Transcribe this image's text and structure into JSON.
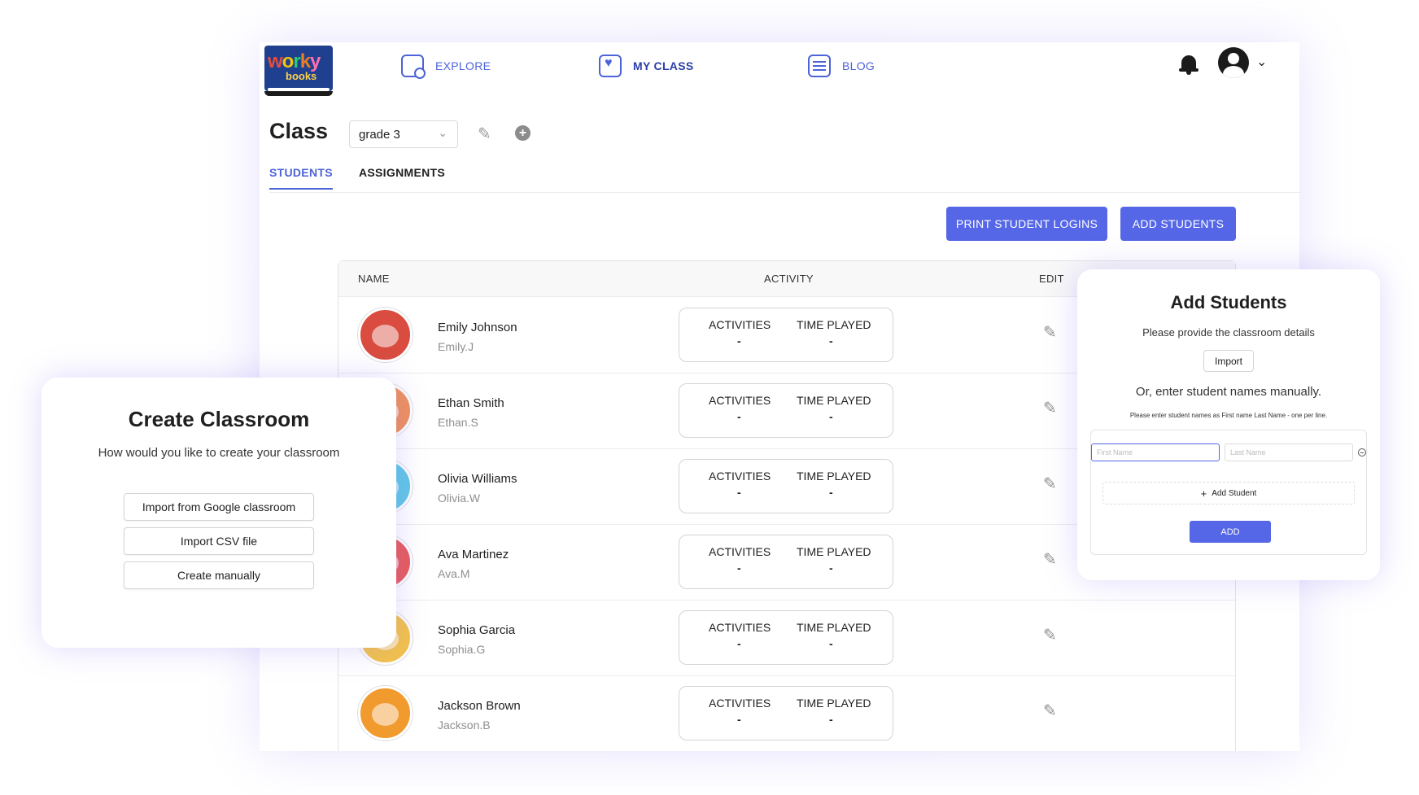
{
  "nav": {
    "items": [
      {
        "label": "EXPLORE",
        "icon": "explore-icon"
      },
      {
        "label": "MY CLASS",
        "icon": "heart-icon"
      },
      {
        "label": "BLOG",
        "icon": "blog-icon"
      }
    ]
  },
  "logo": {
    "top": "worky",
    "bottom": "books"
  },
  "page": {
    "title": "Class",
    "grade_value": "grade 3",
    "tabs": [
      "STUDENTS",
      "ASSIGNMENTS"
    ],
    "print_label": "PRINT STUDENT LOGINS",
    "add_label": "ADD STUDENTS"
  },
  "table": {
    "headers": [
      "NAME",
      "ACTIVITY",
      "EDIT"
    ],
    "activity_labels": [
      "ACTIVITIES",
      "TIME PLAYED"
    ],
    "rows": [
      {
        "name": "Emily Johnson",
        "username": "Emily.J",
        "activities": "-",
        "time": "-",
        "color": "#d94c3f"
      },
      {
        "name": "Ethan Smith",
        "username": "Ethan.S",
        "activities": "-",
        "time": "-",
        "color": "#f0905a"
      },
      {
        "name": "Olivia Williams",
        "username": "Olivia.W",
        "activities": "-",
        "time": "-",
        "color": "#5fc7e6"
      },
      {
        "name": "Ava Martinez",
        "username": "Ava.M",
        "activities": "-",
        "time": "-",
        "color": "#e85a5a"
      },
      {
        "name": "Sophia Garcia",
        "username": "Sophia.G",
        "activities": "-",
        "time": "-",
        "color": "#f3c24a"
      },
      {
        "name": "Jackson Brown",
        "username": "Jackson.B",
        "activities": "-",
        "time": "-",
        "color": "#f19a2e"
      }
    ]
  },
  "create_popup": {
    "title": "Create Classroom",
    "subtitle": "How would you like to create your classroom",
    "options": [
      "Import from Google classroom",
      "Import CSV file",
      "Create manually"
    ]
  },
  "add_popup": {
    "title": "Add Students",
    "subtitle": "Please provide the classroom details",
    "import_label": "Import",
    "or_text": "Or, enter student names manually.",
    "hint": "Please enter student names as First name Last Name - one per line.",
    "first_placeholder": "First Name",
    "last_placeholder": "Last Name",
    "add_student_label": "Add Student",
    "submit_label": "ADD"
  },
  "colors": {
    "accent": "#5567e6",
    "nav": "#4d63d8"
  }
}
